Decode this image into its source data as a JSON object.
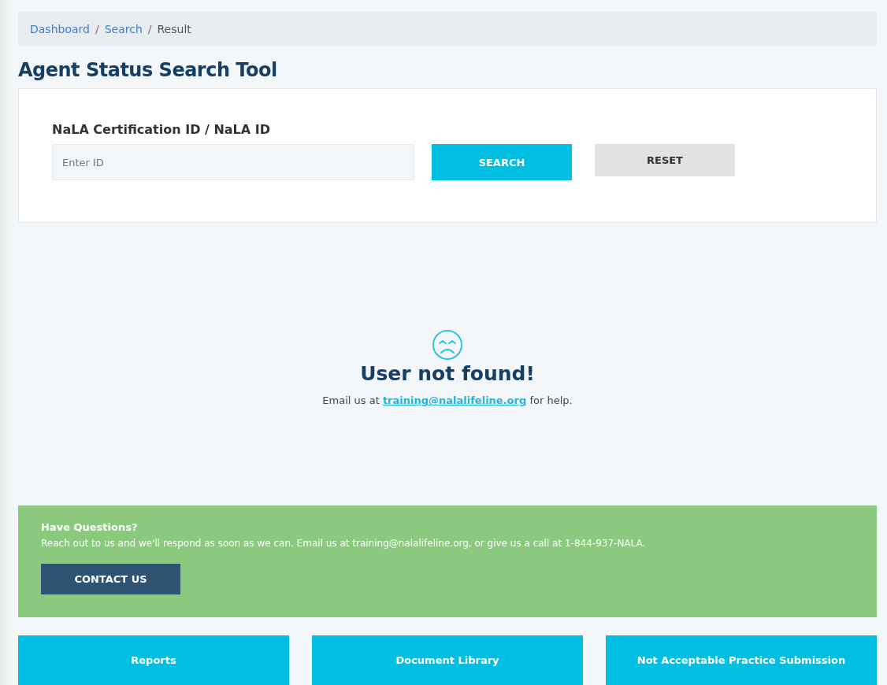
{
  "breadcrumb": [
    {
      "label": "Dashboard",
      "kind": "link"
    },
    {
      "label": "Search",
      "kind": "link"
    },
    {
      "label": "Result",
      "kind": "current"
    }
  ],
  "separator": "/",
  "title": "Agent Status Search Tool",
  "search_form": {
    "label": "NaLA Certification ID / NaLA ID",
    "placeholder": "Enter ID",
    "buttons": [
      {
        "label": "SEARCH",
        "kind": "primary"
      },
      {
        "label": "RESET",
        "kind": "secondary"
      }
    ]
  },
  "result": {
    "heading": "User not found!",
    "message_before": "Email us at",
    "link": "training@nalalifeline.org",
    "message_after": "for help."
  },
  "questions": {
    "heading": "Have Questions?",
    "text": "Reach out to us and we'll respond as soon as we can. Email us at training@nalalifeline.org, or give us a call at 1-844-937-NALA.",
    "button": "CONTACT US"
  },
  "tiles": [
    "Reports",
    "Document Library",
    "Not Acceptable Practice Submission"
  ]
}
